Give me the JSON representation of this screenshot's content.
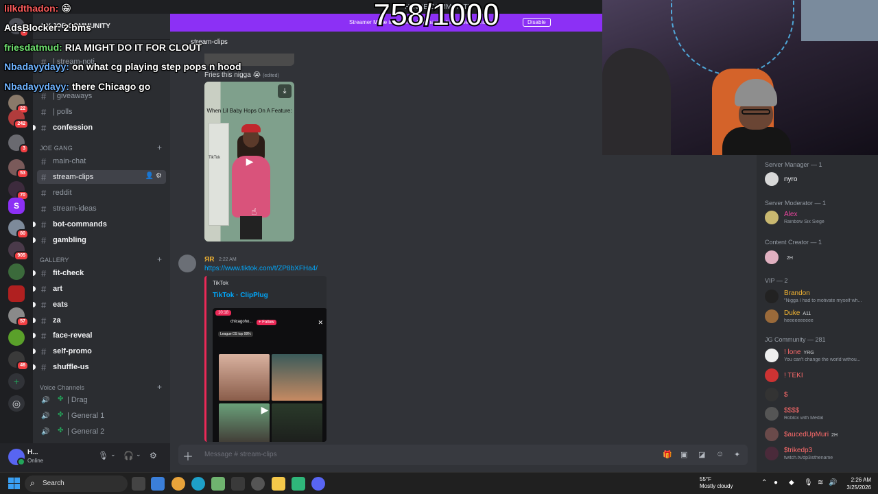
{
  "window": {
    "title": "HJNOE COMMUNITY"
  },
  "servers": [
    {
      "badge": "1"
    },
    {
      "badge": "22"
    },
    {
      "badge": "242"
    },
    {
      "badge": "3"
    },
    {
      "badge": "53"
    },
    {
      "badge": "70"
    },
    {
      "badge": ""
    },
    {
      "badge": "80"
    },
    {
      "badge": "905"
    },
    {
      "badge": ""
    },
    {
      "badge": ""
    },
    {
      "badge": "57"
    },
    {
      "badge": ""
    },
    {
      "badge": "46"
    }
  ],
  "guild": {
    "name": "HY JOE COMMUNITY"
  },
  "channels": {
    "top": [
      {
        "label": "| stream-noti"
      },
      {
        "label": "| giveaways"
      },
      {
        "label": "| polls"
      },
      {
        "label": "confession"
      }
    ],
    "joe_gang": {
      "name": "JOE GANG",
      "items": [
        {
          "label": "main-chat"
        },
        {
          "label": "stream-clips"
        },
        {
          "label": "reddit"
        },
        {
          "label": "stream-ideas"
        },
        {
          "label": "bot-commands"
        },
        {
          "label": "gambling"
        }
      ]
    },
    "gallery": {
      "name": "GALLERY",
      "items": [
        {
          "label": "fit-check"
        },
        {
          "label": "art"
        },
        {
          "label": "eats"
        },
        {
          "label": "za"
        },
        {
          "label": "face-reveal"
        },
        {
          "label": "self-promo"
        },
        {
          "label": "shuffle-us"
        }
      ]
    },
    "voice": {
      "name": "Voice Channels",
      "items": [
        {
          "label": "| Drag"
        },
        {
          "label": "| General 1"
        },
        {
          "label": "| General 2"
        }
      ]
    }
  },
  "user": {
    "name": "H...",
    "status": "Online"
  },
  "chat": {
    "channel": "stream-clips",
    "msg1_text": "Fries this nigga 😭",
    "msg1_edited": "(edited)",
    "video_caption": "When Lil Baby Hops On A Feature:",
    "video_watermark": "TikTok",
    "msg2_author": "ЯR",
    "msg2_time": "2:22 AM",
    "msg2_link": "https://www.tiktok.com/t/ZP8bXFHa4/",
    "embed_provider": "TikTok",
    "embed_title": "TikTok · ClipPlug",
    "embed_time": "10:18",
    "embed_user": "chicagoho...",
    "embed_follow": "+ Follow",
    "embed_league": "League DS top 99%",
    "composer_placeholder": "Message #  stream-clips"
  },
  "members": {
    "roles": [
      {
        "name": "Server Manager — 1"
      },
      {
        "name": "Server Moderator — 1"
      },
      {
        "name": "Content Creator — 1"
      },
      {
        "name": "VIP — 2"
      },
      {
        "name": "JG Community — 281"
      }
    ],
    "list": [
      {
        "name": "nyro",
        "sub": "",
        "tag": "",
        "color": "#f2f3f5"
      },
      {
        "name": "Alex",
        "sub": "Rainbow Six Siege",
        "tag": "",
        "color": "#eb459e"
      },
      {
        "name": "",
        "sub": "",
        "tag": "2H",
        "color": "#eb459e"
      },
      {
        "name": "Brandon",
        "sub": "\"Nigga I had to motivate myself wh...",
        "tag": "",
        "color": "#f0b232"
      },
      {
        "name": "Duke",
        "sub": "heeeeeeeeee",
        "tag": "A11",
        "color": "#f0b232"
      },
      {
        "name": "! lone",
        "sub": "You can't change the world withou...",
        "tag": "YRG",
        "color": "#ff6b6b"
      },
      {
        "name": "! TEKI",
        "sub": "",
        "tag": "",
        "color": "#ff6b6b"
      },
      {
        "name": "$",
        "sub": "",
        "tag": "",
        "color": "#ff6b6b"
      },
      {
        "name": "$$$$",
        "sub": "Roblox with Medal",
        "tag": "",
        "color": "#ff6b6b"
      },
      {
        "name": "$aucedUpMuri",
        "sub": "",
        "tag": "2H",
        "color": "#ff6b6b"
      },
      {
        "name": "$trikedp3",
        "sub": "twitch.tv/dp3isthename",
        "tag": "",
        "color": "#ff6b6b"
      }
    ]
  },
  "overlay": {
    "goal": "758/1000",
    "banner_text": "Streamer Mode is enabled. Usernames have been truncated.",
    "banner_button": "Disable",
    "chat": [
      {
        "user": "lilkdthadon:",
        "text": "😁",
        "color": "#ff5d5d"
      },
      {
        "user": "AdsBlocker:",
        "text": "2 bms",
        "color": "#ffffff"
      },
      {
        "user": "friesdatmud:",
        "text": "RIA MIGHT DO IT FOR CLOUT",
        "color": "#6fe06f"
      },
      {
        "user": "Nbadayydayy:",
        "text": "on what cg playing step pops n hood",
        "color": "#6fb3ff"
      },
      {
        "user": "Nbadayydayy:",
        "text": "there Chicago go",
        "color": "#6fb3ff"
      }
    ]
  },
  "taskbar": {
    "search": "Search",
    "temp": "55°F",
    "weather": "Mostly cloudy",
    "time": "2:26 AM",
    "date": "3/25/2026"
  },
  "colors": {
    "accent": "#5865f2",
    "streamer": "#8c30f5",
    "link": "#00a8fc"
  }
}
